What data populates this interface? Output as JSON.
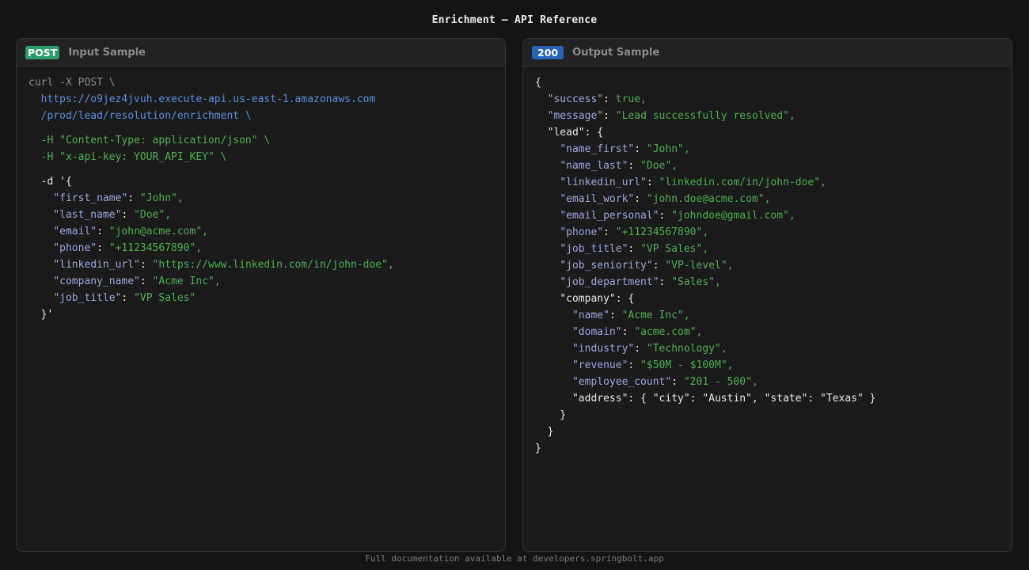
{
  "page": {
    "title": "Enrichment — API Reference",
    "footer": "Full documentation available at developers.springbolt.app"
  },
  "input_panel": {
    "badge": "POST",
    "label": "Input Sample",
    "curl_cmd": "curl -X POST \\",
    "url_line1": "https://o9jez4jvuh.execute-api.us-east-1.amazonaws.com",
    "url_line2": "/prod/lead/resolution/enrichment \\",
    "header1": "-H \"Content-Type: application/json\" \\",
    "header2": "-H \"x-api-key: YOUR_API_KEY\" \\",
    "data_open": "-d '{",
    "body": [
      {
        "key": "\"first_name\"",
        "value": "\"John\"",
        "comma": ","
      },
      {
        "key": "\"last_name\"",
        "value": "\"Doe\"",
        "comma": ","
      },
      {
        "key": "\"email\"",
        "value": "\"john@acme.com\"",
        "comma": ","
      },
      {
        "key": "\"phone\"",
        "value": "\"+11234567890\"",
        "comma": ","
      },
      {
        "key": "\"linkedin_url\"",
        "value": "\"https://www.linkedin.com/in/john-doe\"",
        "comma": ","
      },
      {
        "key": "\"company_name\"",
        "value": "\"Acme Inc\"",
        "comma": ","
      },
      {
        "key": "\"job_title\"",
        "value": "\"VP Sales\"",
        "comma": ""
      }
    ],
    "data_close": "}'"
  },
  "output_panel": {
    "badge": "200",
    "label": "Output Sample",
    "success_key": "\"success\"",
    "success_val": "true,",
    "message_key": "\"message\"",
    "message_val": "\"Lead successfully resolved\",",
    "lead_key": "\"lead\"",
    "lead_fields": [
      {
        "key": "\"name_first\"",
        "value": "\"John\","
      },
      {
        "key": "\"name_last\"",
        "value": "\"Doe\","
      },
      {
        "key": "\"linkedin_url\"",
        "value": "\"linkedin.com/in/john-doe\","
      },
      {
        "key": "\"email_work\"",
        "value": "\"john.doe@acme.com\","
      },
      {
        "key": "\"email_personal\"",
        "value": "\"johndoe@gmail.com\","
      },
      {
        "key": "\"phone\"",
        "value": "\"+11234567890\","
      },
      {
        "key": "\"job_title\"",
        "value": "\"VP Sales\","
      },
      {
        "key": "\"job_seniority\"",
        "value": "\"VP-level\","
      },
      {
        "key": "\"job_department\"",
        "value": "\"Sales\","
      }
    ],
    "company_key": "\"company\"",
    "company_fields": [
      {
        "key": "\"name\"",
        "value": "\"Acme Inc\","
      },
      {
        "key": "\"domain\"",
        "value": "\"acme.com\","
      },
      {
        "key": "\"industry\"",
        "value": "\"Technology\","
      },
      {
        "key": "\"revenue\"",
        "value": "\"$50M - $100M\","
      },
      {
        "key": "\"employee_count\"",
        "value": "\"201 - 500\","
      }
    ],
    "address_line": "\"address\": { \"city\": \"Austin\", \"state\": \"Texas\" }"
  }
}
